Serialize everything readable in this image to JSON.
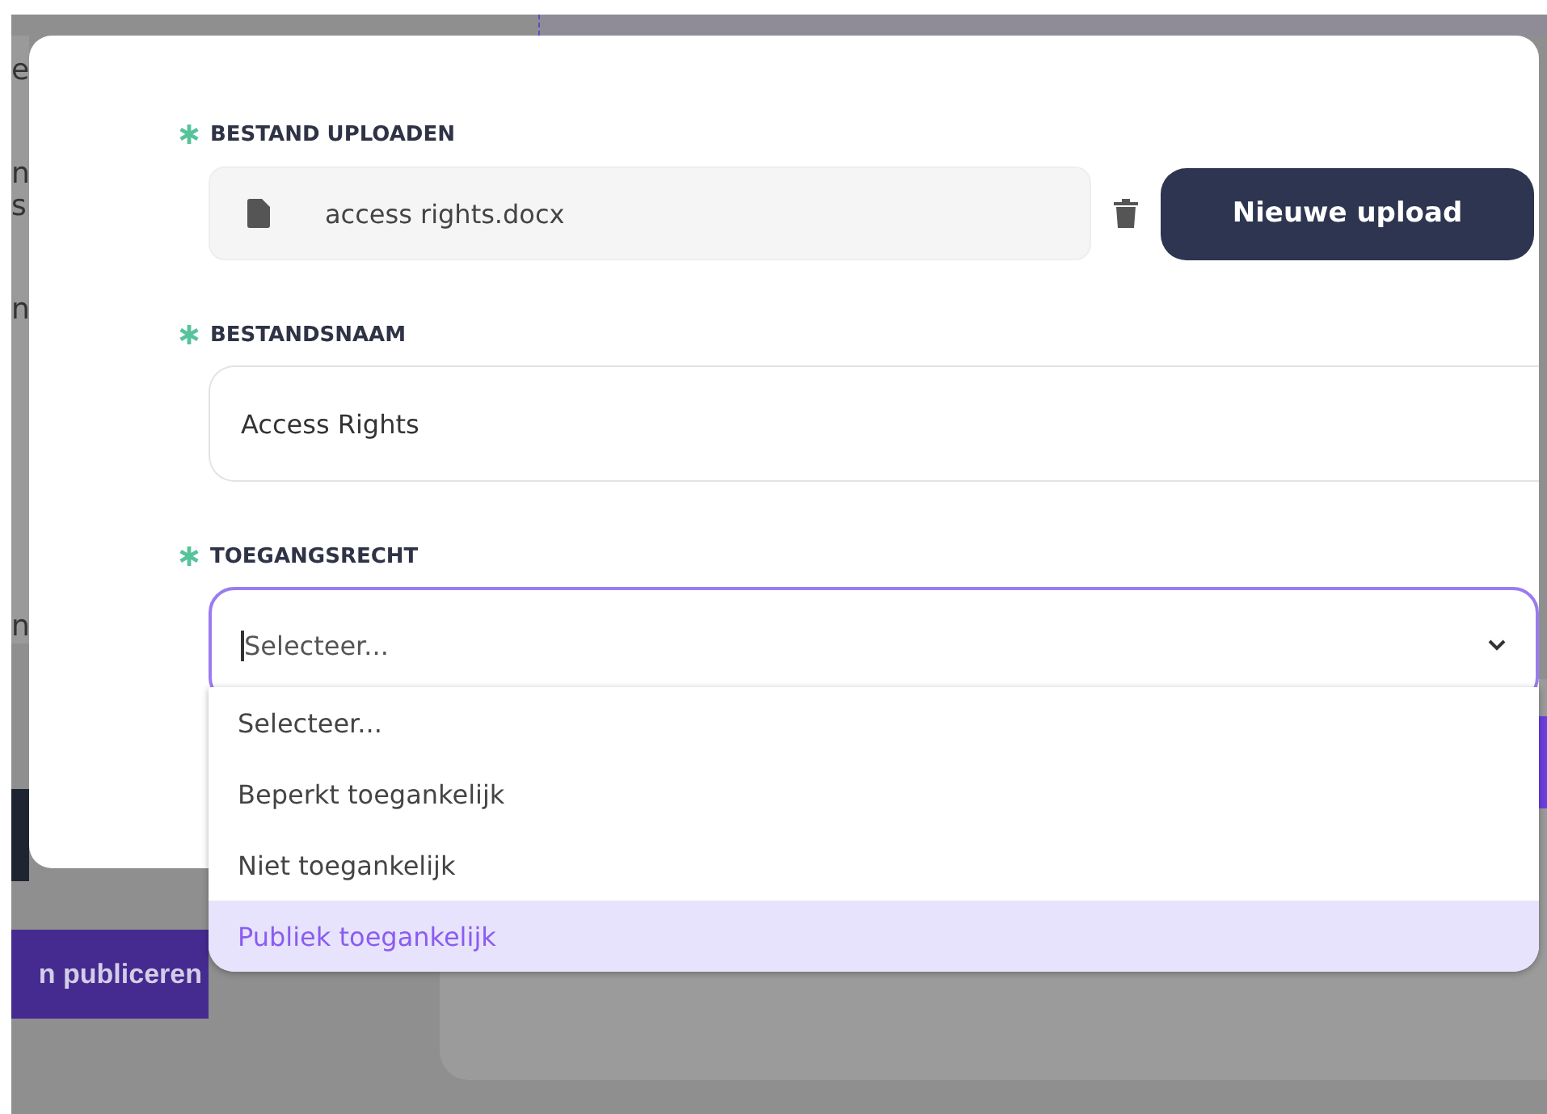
{
  "background": {
    "side_texts": [
      "e",
      "n",
      "s",
      "n",
      "n"
    ],
    "publish_button": "n publiceren"
  },
  "dialog": {
    "upload": {
      "label": "BESTAND UPLOADEN",
      "required": true,
      "file_name": "access rights.docx",
      "button": "Nieuwe upload"
    },
    "file_name": {
      "label": "BESTANDSNAAM",
      "required": true,
      "value": "Access Rights"
    },
    "access": {
      "label": "TOEGANGSRECHT",
      "required": true,
      "placeholder": "Selecteer...",
      "expanded": true,
      "options": [
        {
          "label": "Selecteer...",
          "selected": false
        },
        {
          "label": "Beperkt toegankelijk",
          "selected": false
        },
        {
          "label": "Niet toegankelijk",
          "selected": false
        },
        {
          "label": "Publiek toegankelijk",
          "selected": true
        }
      ]
    }
  }
}
